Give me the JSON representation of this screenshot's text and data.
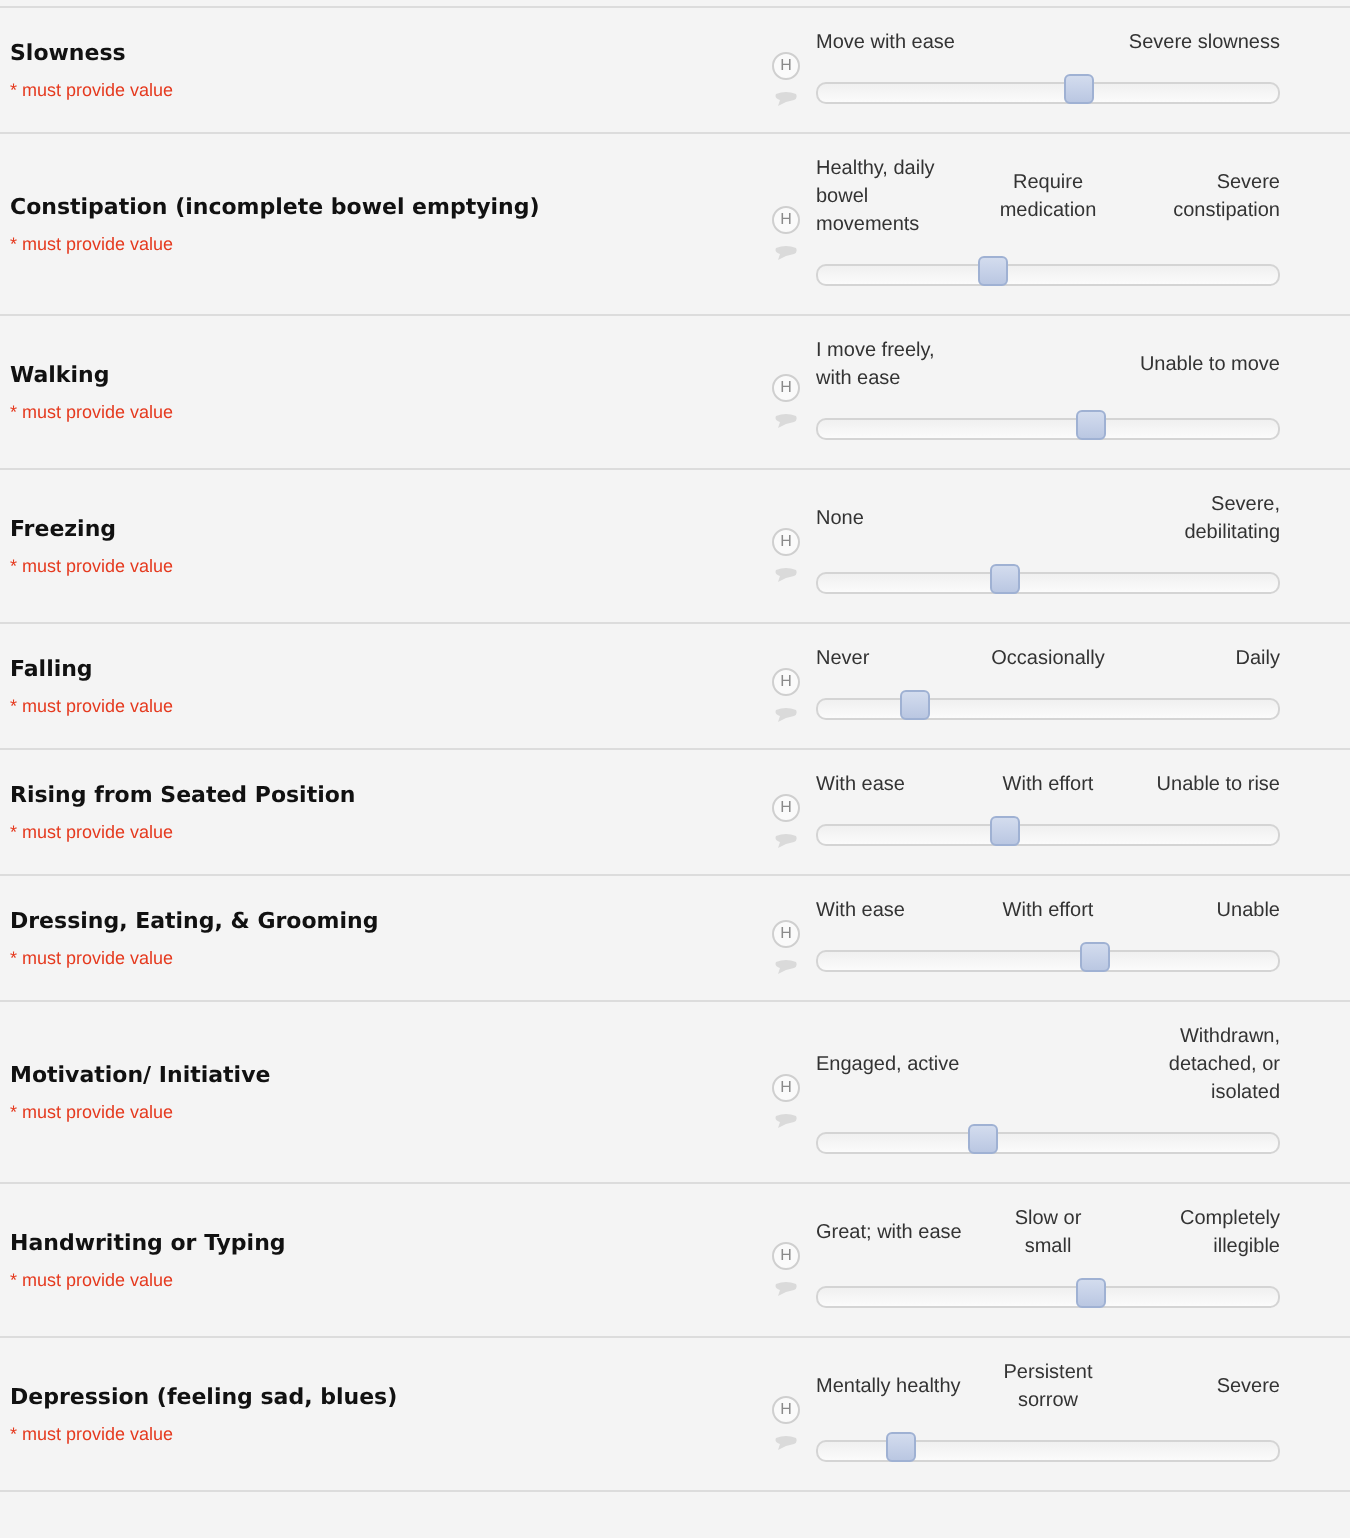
{
  "questions": [
    {
      "title": "Slowness",
      "note": "* must provide value",
      "help_badge": "H",
      "level": 0.57,
      "labels": [
        {
          "text": "Move with ease",
          "kind": "left"
        },
        {
          "text": "Severe slowness",
          "kind": "right"
        }
      ]
    },
    {
      "title": "Constipation (incomplete bowel emptying)",
      "note": "* must provide value",
      "help_badge": "H",
      "level": 0.37,
      "labels": [
        {
          "text": "Healthy, daily bowel movements",
          "kind": "left"
        },
        {
          "text": "Require medication",
          "kind": "center"
        },
        {
          "text": "Severe constipation",
          "kind": "right"
        }
      ]
    },
    {
      "title": "Walking",
      "note": "* must provide value",
      "help_badge": "H",
      "level": 0.6,
      "labels": [
        {
          "text": "I move freely, with ease",
          "kind": "left"
        },
        {
          "text": "Unable to move",
          "kind": "right"
        }
      ]
    },
    {
      "title": "Freezing",
      "note": "* must provide value",
      "help_badge": "H",
      "level": 0.4,
      "labels": [
        {
          "text": "None",
          "kind": "left"
        },
        {
          "text": "Severe, debilitating",
          "kind": "right"
        }
      ]
    },
    {
      "title": "Falling",
      "note": "* must provide value",
      "help_badge": "H",
      "level": 0.19,
      "labels": [
        {
          "text": "Never",
          "kind": "left"
        },
        {
          "text": "Occasionally",
          "kind": "center"
        },
        {
          "text": "Daily",
          "kind": "right"
        }
      ]
    },
    {
      "title": "Rising from Seated Position",
      "note": "* must provide value",
      "help_badge": "H",
      "level": 0.4,
      "labels": [
        {
          "text": "With ease",
          "kind": "left"
        },
        {
          "text": "With effort",
          "kind": "center"
        },
        {
          "text": "Unable to rise",
          "kind": "right"
        }
      ]
    },
    {
      "title": "Dressing, Eating, & Grooming",
      "note": "* must provide value",
      "help_badge": "H",
      "level": 0.61,
      "labels": [
        {
          "text": "With ease",
          "kind": "left"
        },
        {
          "text": "With effort",
          "kind": "center"
        },
        {
          "text": "Unable",
          "kind": "right"
        }
      ]
    },
    {
      "title": "Motivation/ Initiative",
      "note": "* must provide value",
      "help_badge": "H",
      "level": 0.35,
      "labels": [
        {
          "text": "Engaged, active",
          "kind": "left"
        },
        {
          "text": "Withdrawn, detached, or isolated",
          "kind": "right"
        }
      ]
    },
    {
      "title": "Handwriting or Typing",
      "note": "* must provide value",
      "help_badge": "H",
      "level": 0.6,
      "labels": [
        {
          "text": "Great; with ease",
          "kind": "left"
        },
        {
          "text": "Slow or small",
          "kind": "center"
        },
        {
          "text": "Completely illegible",
          "kind": "right"
        }
      ]
    },
    {
      "title": "Depression (feeling sad, blues)",
      "note": "* must provide value",
      "help_badge": "H",
      "level": 0.16,
      "labels": [
        {
          "text": "Mentally healthy",
          "kind": "left"
        },
        {
          "text": "Persistent sorrow",
          "kind": "center"
        },
        {
          "text": "Severe",
          "kind": "right"
        }
      ]
    }
  ]
}
